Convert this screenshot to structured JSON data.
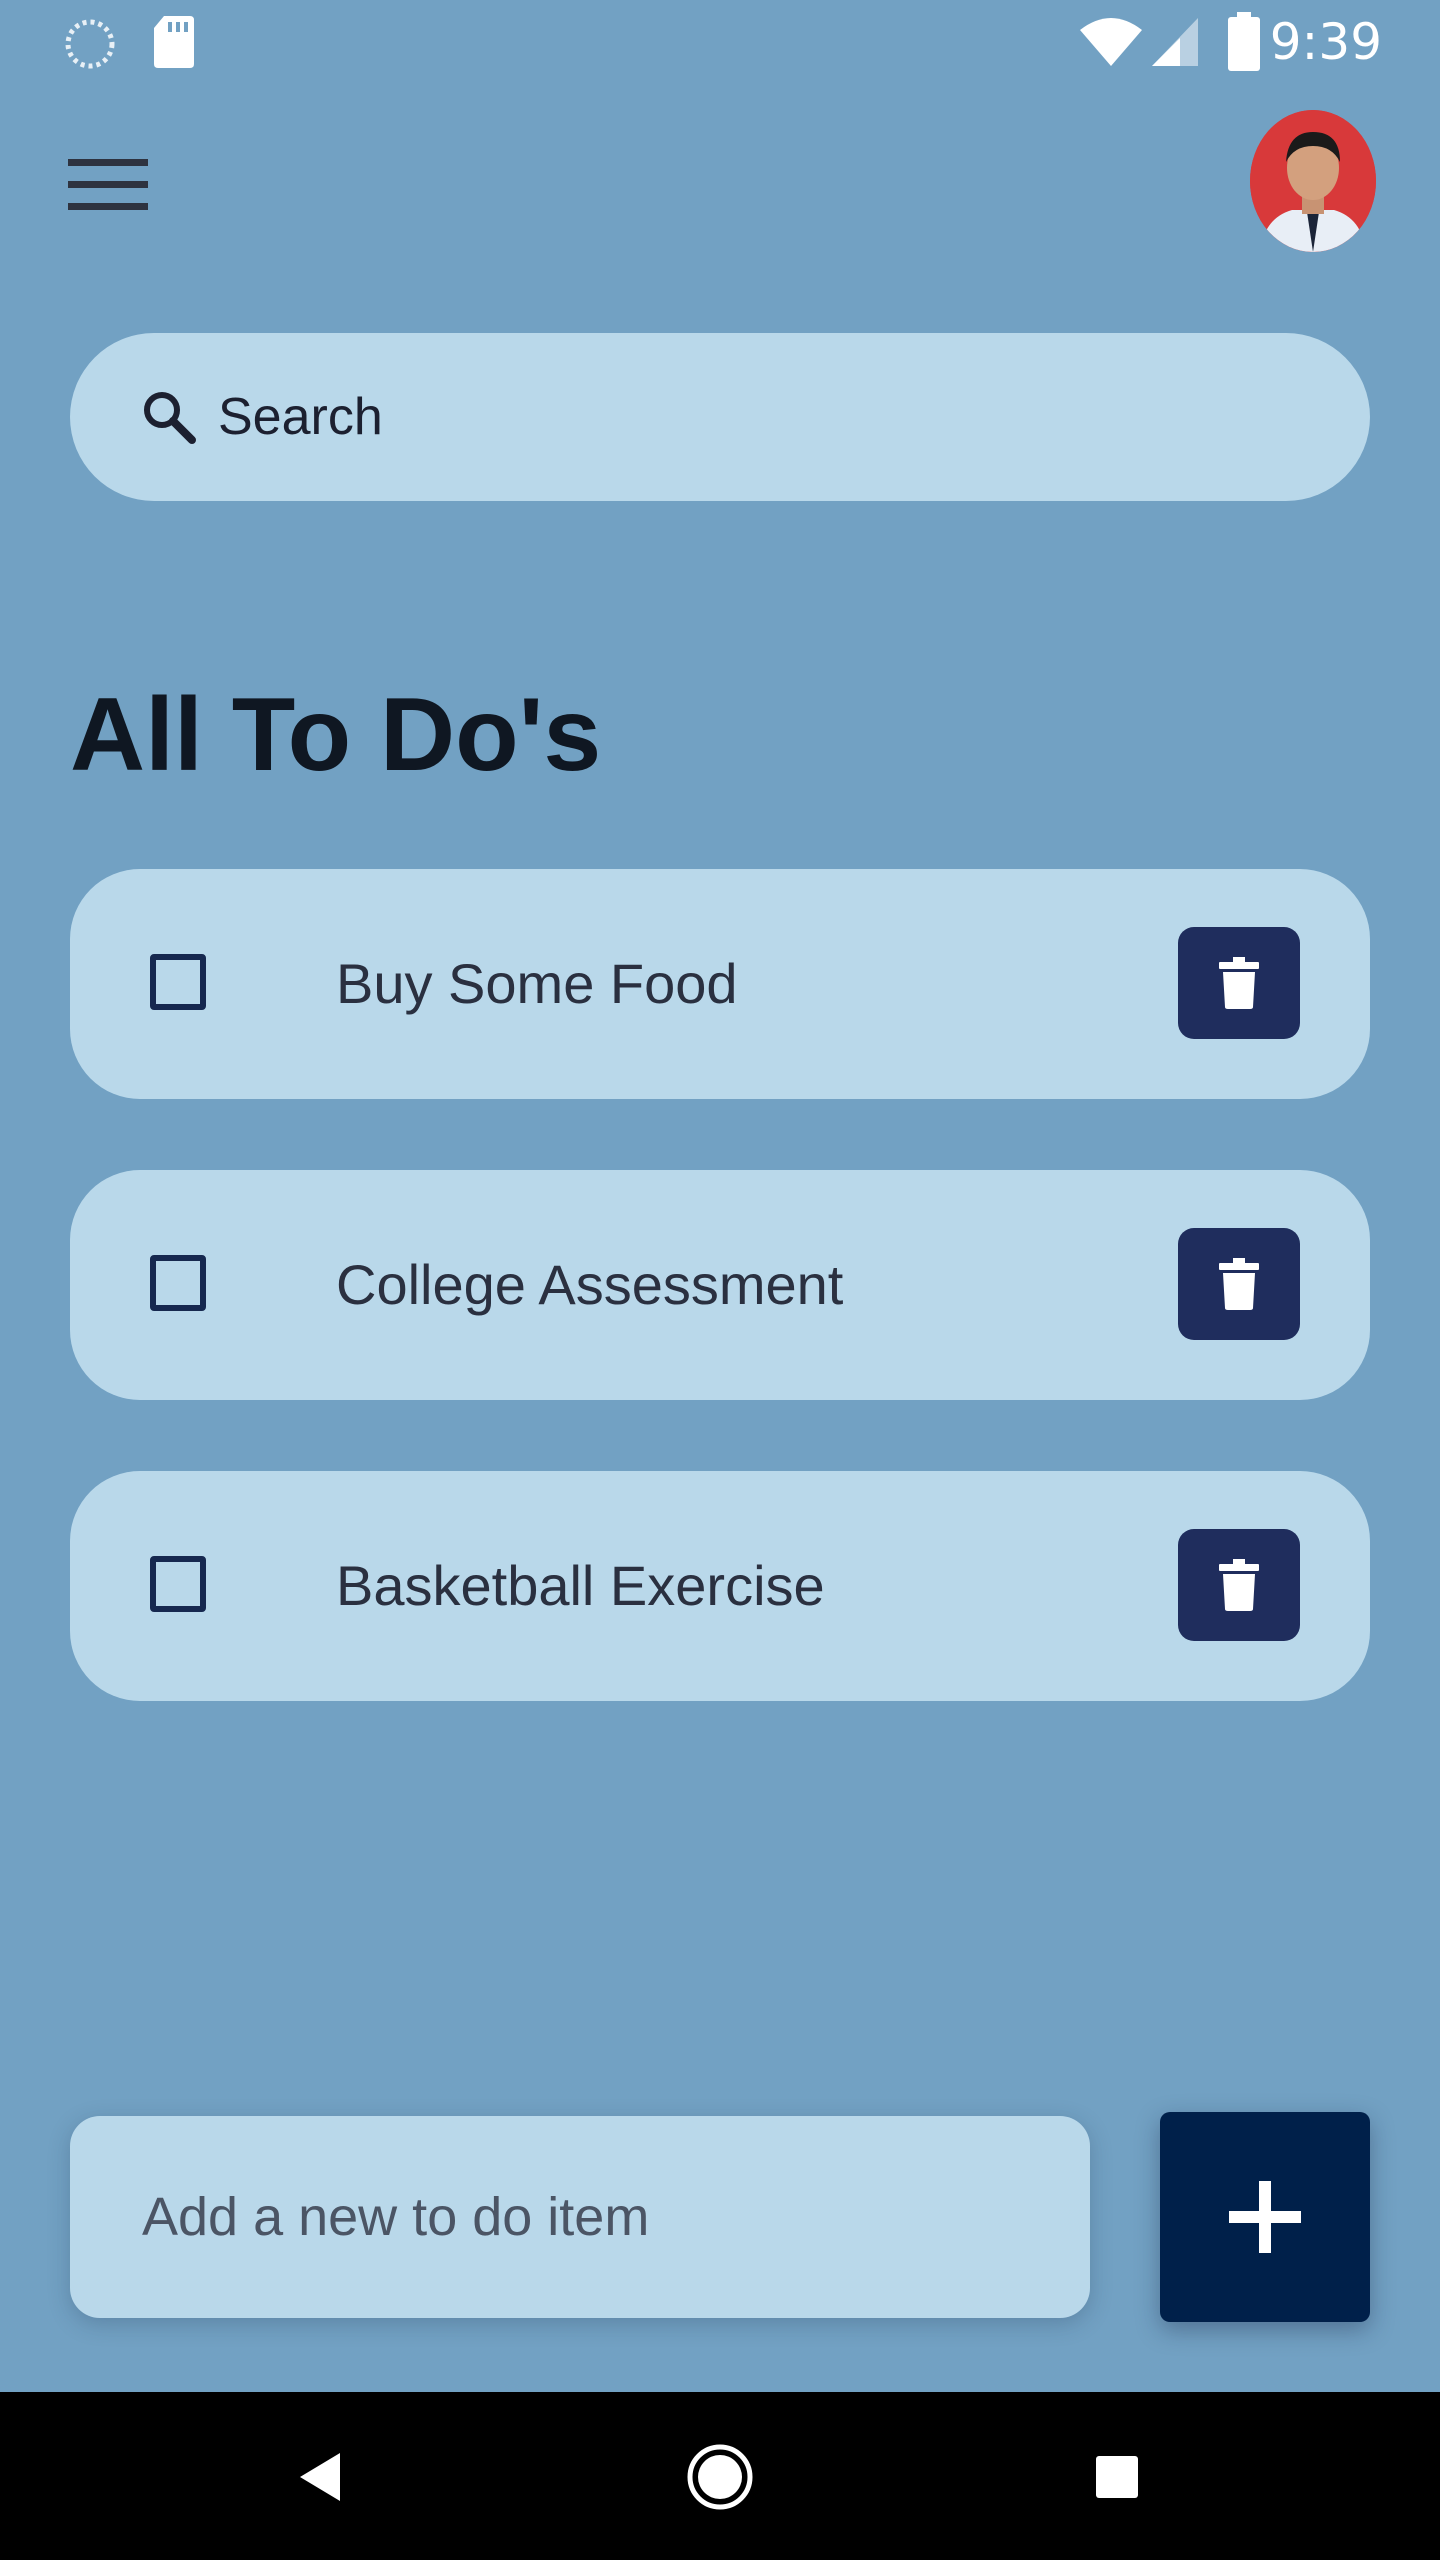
{
  "status_bar": {
    "time": "9:39",
    "icons": [
      "sync-icon",
      "sd-card-icon",
      "wifi-icon",
      "signal-icon",
      "battery-icon"
    ]
  },
  "app_bar": {
    "menu_icon": "hamburger-menu-icon",
    "avatar": "user-avatar"
  },
  "search": {
    "placeholder": "Search",
    "icon": "search-icon"
  },
  "page_title": "All To Do's",
  "todos": [
    {
      "label": "Buy Some Food",
      "checked": false
    },
    {
      "label": "College Assessment",
      "checked": false
    },
    {
      "label": "Basketball Exercise",
      "checked": false
    }
  ],
  "new_item": {
    "placeholder": "Add a new to do item"
  },
  "add_button": {
    "icon": "plus-icon"
  },
  "nav_bar": {
    "icons": [
      "back-icon",
      "home-icon",
      "recents-icon"
    ]
  },
  "colors": {
    "background": "#72a1c3",
    "card": "#b9d8ea",
    "delete_button": "#1f2d5d",
    "add_button": "#00204a",
    "title": "#0f1722"
  }
}
